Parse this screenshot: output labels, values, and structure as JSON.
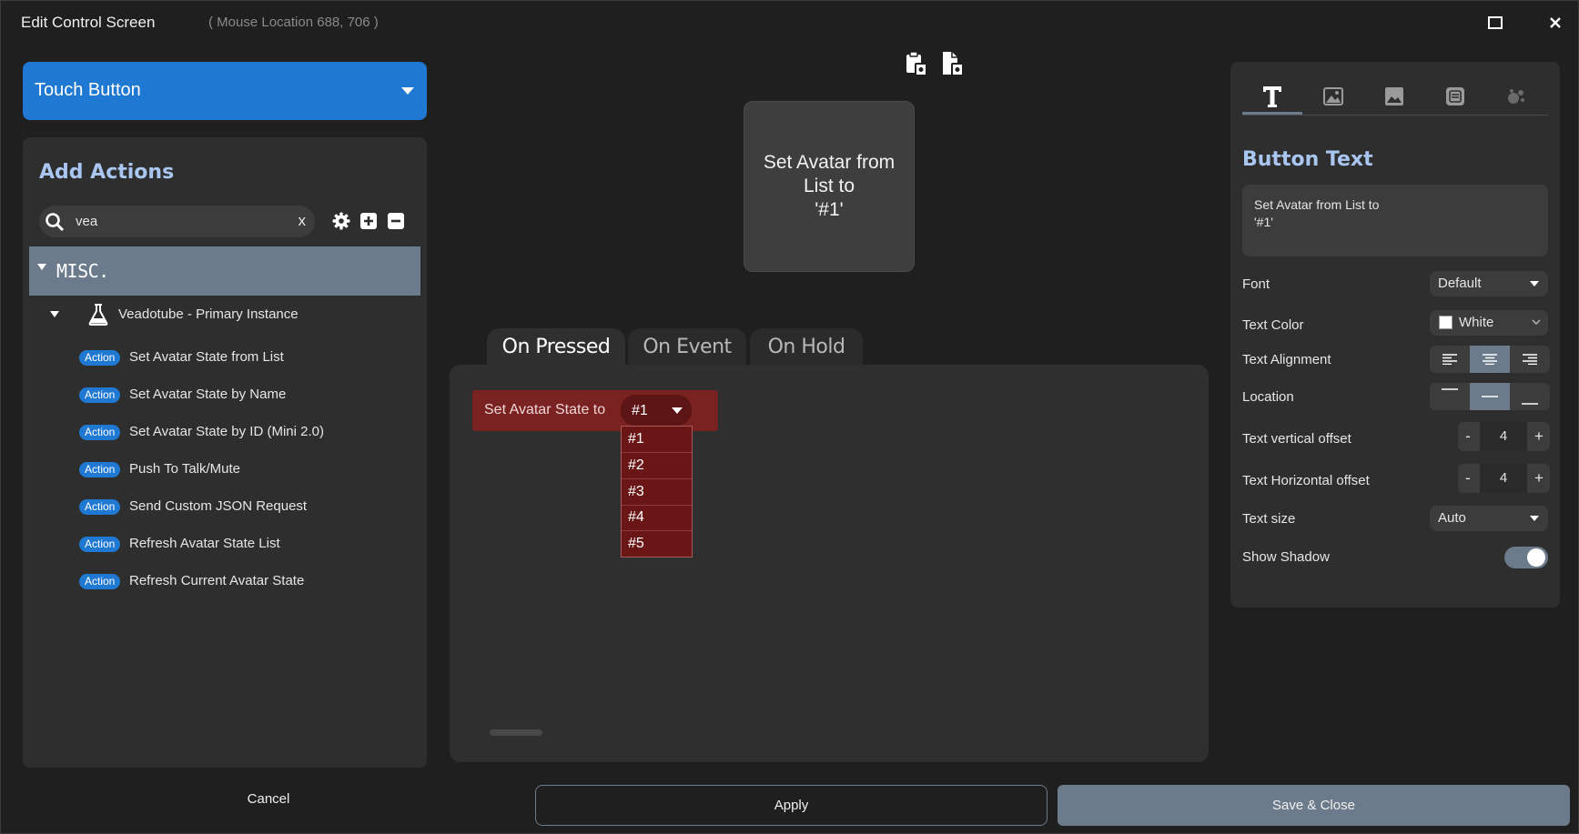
{
  "window": {
    "title": "Edit Control Screen",
    "mouse_location": "( Mouse Location 688, 706 )"
  },
  "control_type": "Touch Button",
  "add_actions": {
    "title": "Add Actions",
    "search_value": "vea",
    "search_clear": "x",
    "category": "MISC.",
    "plugin": "Veadotube - Primary Instance",
    "badge_label": "Action",
    "items": [
      "Set Avatar State from List",
      "Set Avatar State by Name",
      "Set Avatar State by ID (Mini 2.0)",
      "Push To Talk/Mute",
      "Send Custom JSON Request",
      "Refresh Avatar State List",
      "Refresh Current Avatar State"
    ]
  },
  "preview": {
    "text": "Set Avatar from\nList to\n'#1'"
  },
  "tabs": [
    "On Pressed",
    "On Event",
    "On Hold"
  ],
  "active_tab": "On Pressed",
  "action_block": {
    "label": "Set Avatar State to",
    "selected": "#1",
    "options": [
      "#1",
      "#2",
      "#3",
      "#4",
      "#5"
    ]
  },
  "properties": {
    "title": "Button Text",
    "button_text": "Set Avatar from List to\n'#1'",
    "font_label": "Font",
    "font_value": "Default",
    "text_color_label": "Text Color",
    "text_color_value": "White",
    "text_alignment_label": "Text Alignment",
    "location_label": "Location",
    "vertical_offset_label": "Text vertical offset",
    "vertical_offset_value": "4",
    "horizontal_offset_label": "Text Horizontal offset",
    "horizontal_offset_value": "4",
    "text_size_label": "Text size",
    "text_size_value": "Auto",
    "show_shadow_label": "Show Shadow",
    "show_shadow_on": true,
    "stepper_minus": "-",
    "stepper_plus": "+"
  },
  "footer": {
    "cancel": "Cancel",
    "apply": "Apply",
    "save_close": "Save & Close"
  },
  "colors": {
    "accent_blue": "#1f78d1",
    "slate": "#6c7b8c",
    "action_red": "#7a2222",
    "heading_blue": "#a9c6f0"
  }
}
